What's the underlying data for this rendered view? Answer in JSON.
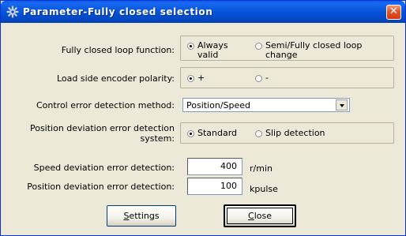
{
  "window": {
    "title": "Parameter-Fully closed selection",
    "close_glyph": "✕",
    "icon": "gear-icon"
  },
  "fields": {
    "loop_function": {
      "label": "Fully closed loop function:",
      "options": [
        {
          "line1": "Always",
          "line2": "valid",
          "selected": true
        },
        {
          "line1": "Semi/Fully closed loop",
          "line2": "change",
          "selected": false
        }
      ]
    },
    "encoder_polarity": {
      "label": "Load side encoder polarity:",
      "options": [
        {
          "label": "+",
          "selected": true
        },
        {
          "label": "-",
          "selected": false
        }
      ]
    },
    "control_error": {
      "label": "Control error detection method:",
      "value": "Position/Speed"
    },
    "position_deviation_system": {
      "label_line1": "Position deviation error detection",
      "label_line2": "system:",
      "options": [
        {
          "label": "Standard",
          "selected": true
        },
        {
          "label": "Slip detection",
          "selected": false
        }
      ]
    },
    "speed_deviation": {
      "label": "Speed deviation error detection:",
      "value": "400",
      "unit": "r/min"
    },
    "position_deviation": {
      "label": "Position deviation error detection:",
      "value": "100",
      "unit": "kpulse"
    }
  },
  "buttons": {
    "settings": {
      "accel": "S",
      "rest": "ettings"
    },
    "close": {
      "accel": "C",
      "rest": "lose"
    }
  }
}
